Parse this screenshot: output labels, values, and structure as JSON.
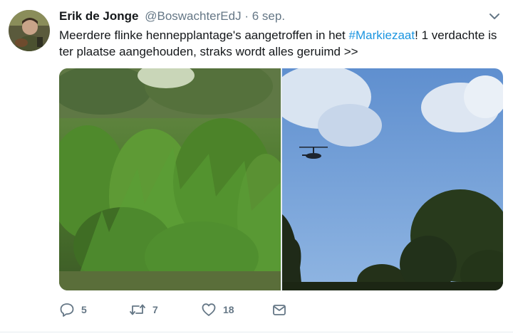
{
  "tweet": {
    "author_name": "Erik de Jonge",
    "author_handle": "@BoswachterEdJ",
    "separator": "·",
    "date": "6 sep.",
    "text_part1": "Meerdere flinke hennepplantage's aangetroffen in het ",
    "hashtag": "#Markiezaat",
    "text_part2": "! 1 verdachte is ter plaatse aangehouden, straks wordt alles geruimd >>",
    "replies": "5",
    "retweets": "7",
    "likes": "18"
  },
  "colors": {
    "link": "#1b95e0",
    "secondary_text": "#657786",
    "primary_text": "#14171a"
  },
  "icons": {
    "reply": "reply-icon",
    "retweet": "retweet-icon",
    "like": "heart-icon",
    "message": "envelope-icon",
    "more": "chevron-down-icon"
  }
}
